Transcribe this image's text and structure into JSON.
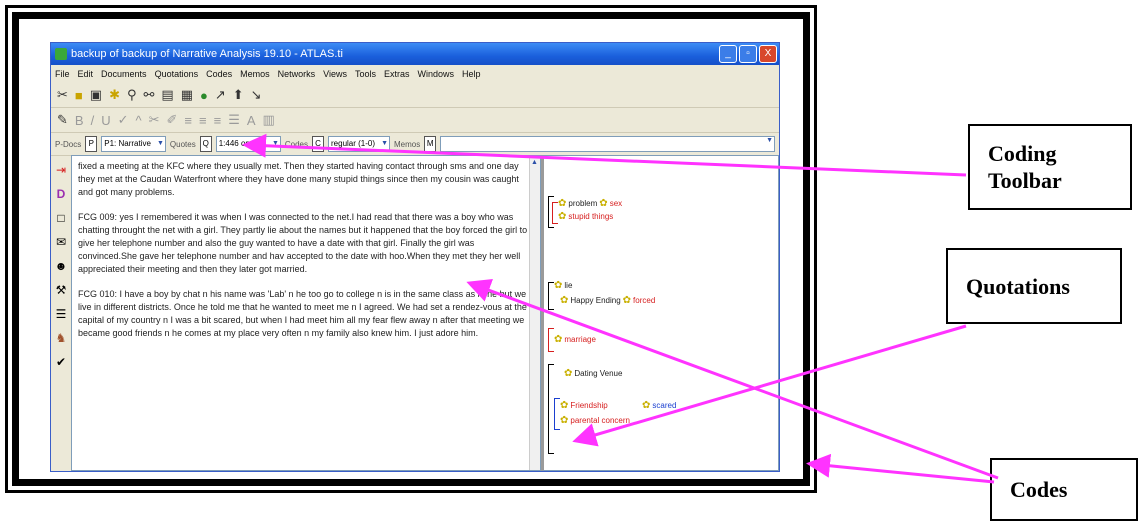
{
  "window": {
    "title": "backup of backup of Narrative Analysis 19.10 - ATLAS.ti",
    "min_label": "_",
    "max_label": "▫",
    "close_label": "X"
  },
  "menu": [
    "File",
    "Edit",
    "Documents",
    "Quotations",
    "Codes",
    "Memos",
    "Networks",
    "Views",
    "Tools",
    "Extras",
    "Windows",
    "Help"
  ],
  "managers": {
    "pdocs_label": "P-Docs",
    "pdocs_value": "P1: Narrative",
    "quotes_label": "Quotes",
    "quotes_value": "1:446 on Boy",
    "codes_label": "Codes",
    "codes_value": "regular (1-0)",
    "memos_label": "Memos"
  },
  "document": {
    "paragraphs": [
      "fixed a meeting at the KFC where they usually met. Then they started having contact through sms and one day they met at the Caudan Waterfront where they have done many stupid things since then my cousin was caught and got many problems.",
      "FCG 009: yes I remembered it was when I was connected to the net.I had read that there was a boy who was chatting throught the net with a girl. They partly lie about the names but it happened that the boy forced the girl to give her telephone number and also the guy wanted to have a date with that girl. Finally the girl was convinced.She gave her telephone number and hav accepted to the date with hoo.When they met they her well appreciated their meeting and then they later got married.",
      "FCG 010: I have a boy by chat n his name was 'Lab' n he too go to college n is in the same class as mine but we live in different districts. Once he told me that he wanted to meet me n I agreed. We had set a rendez-vous at the capital of my country n I was a bit scared, but when I had meet him all my fear flew away n after that meeting we became good friends n he comes at my place very often n my family also knew him. I just adore him."
    ]
  },
  "codes": {
    "problem": "problem",
    "sex": "sex",
    "stupid_things": "stupid things",
    "lie": "lie",
    "happy_ending": "Happy Ending",
    "forced": "forced",
    "marriage": "marriage",
    "dating_venue": "Dating Venue",
    "friendship": "Friendship",
    "scared": "scared",
    "parental_concern": "parental concern"
  },
  "callouts": {
    "coding_toolbar_line1": "Coding",
    "coding_toolbar_line2": "Toolbar",
    "quotations": "Quotations",
    "codes": "Codes"
  },
  "colors": {
    "arrow": "#ff33ff",
    "code_red": "#d61e1e",
    "code_blue": "#1a3fd0",
    "titlebar": "#1a5fdc"
  },
  "icons": {
    "main_toolbar": [
      "scissors-icon",
      "yellow-box-icon",
      "save-icon",
      "code-icon",
      "search-icon",
      "link-icon",
      "doc-icon",
      "table-icon",
      "network-icon",
      "arrow-icon",
      "up-icon",
      "down-icon"
    ],
    "edit_toolbar": [
      "pen-icon",
      "bold-icon",
      "italic-icon",
      "underline-icon",
      "check-icon",
      "up-icon",
      "cut-icon",
      "brush-icon",
      "align-left-icon",
      "align-center-icon",
      "align-right-icon",
      "list-icon",
      "font-icon",
      "format-icon"
    ],
    "side_toolbar": [
      "red-arrow-icon",
      "d-icon",
      "box-icon",
      "note-icon",
      "person-icon",
      "tool-icon",
      "list-icon",
      "figure-icon",
      "check-icon"
    ]
  }
}
